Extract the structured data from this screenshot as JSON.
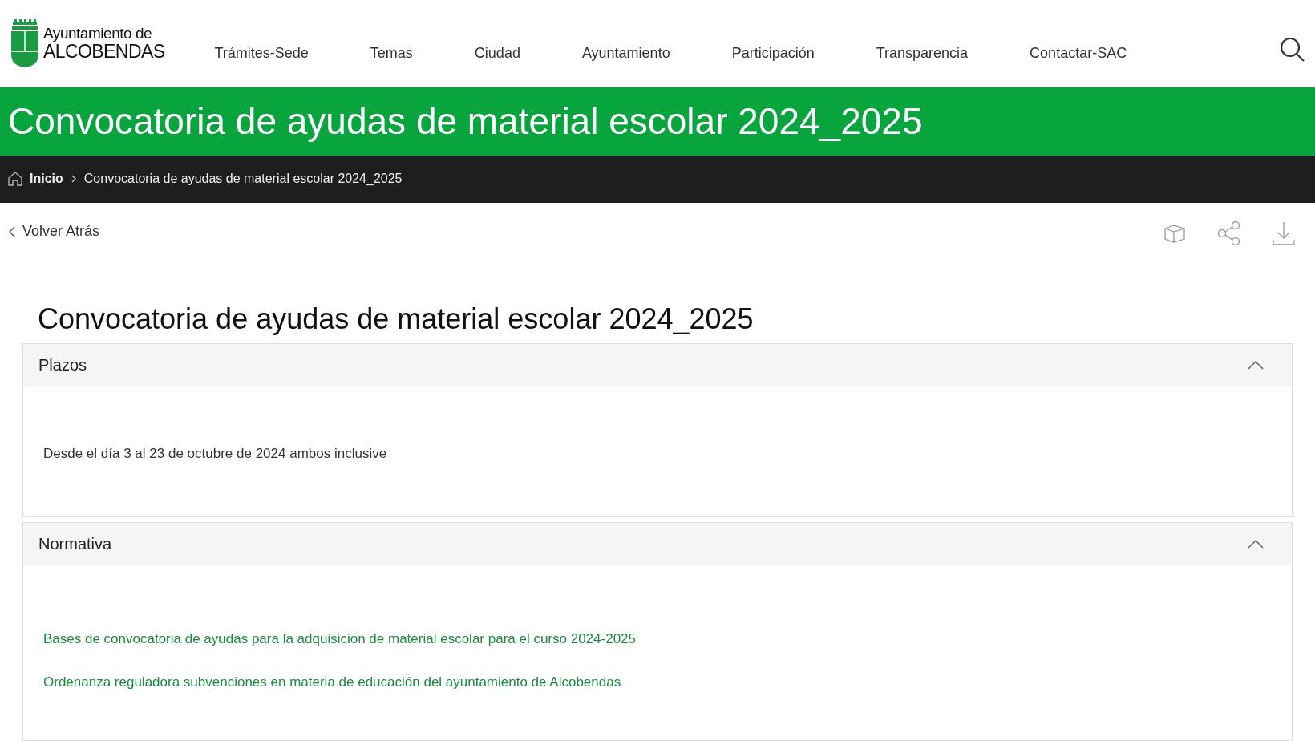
{
  "logo": {
    "line_1": "Ayuntamiento de",
    "line_2": "ALCOBENDAS"
  },
  "nav": [
    {
      "label": "Trámites-Sede"
    },
    {
      "label": "Temas"
    },
    {
      "label": "Ciudad"
    },
    {
      "label": "Ayuntamiento"
    },
    {
      "label": "Participación"
    },
    {
      "label": "Transparencia"
    },
    {
      "label": "Contactar-SAC"
    }
  ],
  "banner": {
    "title": "Convocatoria de ayudas de material escolar 2024_2025"
  },
  "breadcrumb": [
    {
      "label": "Inicio"
    },
    {
      "label": "Convocatoria de ayudas de material escolar 2024_2025"
    }
  ],
  "back_link": "Volver Atrás",
  "page_title": "Convocatoria de ayudas de material escolar 2024_2025",
  "sections": [
    {
      "title": "Plazos",
      "expanded": true,
      "items": [
        {
          "kind": "text",
          "text": "Desde el día 3 al 23 de octubre de 2024 ambos inclusive"
        }
      ]
    },
    {
      "title": "Normativa",
      "expanded": true,
      "items": [
        {
          "kind": "link",
          "text": "Bases de convocatoria de ayudas para la adquisición de material escolar para el curso 2024-2025"
        },
        {
          "kind": "link",
          "text": "Ordenanza reguladora subvenciones en materia de educación del ayuntamiento de Alcobendas"
        }
      ]
    }
  ]
}
